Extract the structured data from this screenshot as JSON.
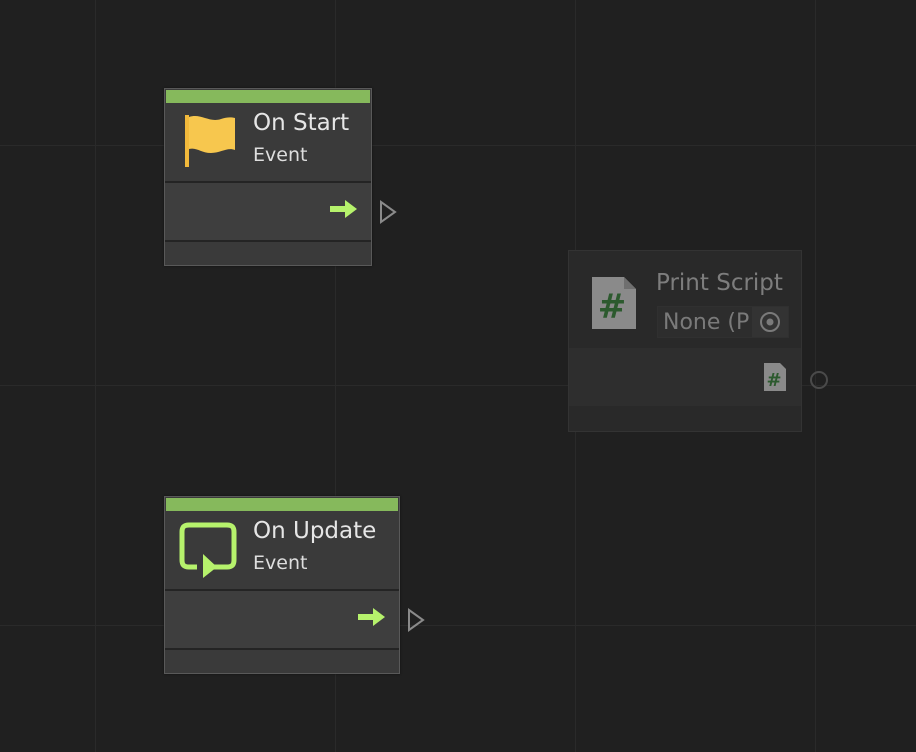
{
  "nodes": {
    "on_start": {
      "title": "On Start",
      "subtitle": "Event"
    },
    "on_update": {
      "title": "On Update",
      "subtitle": "Event"
    },
    "print_script": {
      "title": "Print Script",
      "field_value": "None (P"
    }
  },
  "colors": {
    "canvas": "#202020",
    "event_header": "#86b95c",
    "flow_arrow": "#b6f26c",
    "flag": "#f7c74e"
  },
  "icons": {
    "on_start": "flag-icon",
    "on_update": "loop-icon",
    "print_script": "csharp-script-icon"
  }
}
